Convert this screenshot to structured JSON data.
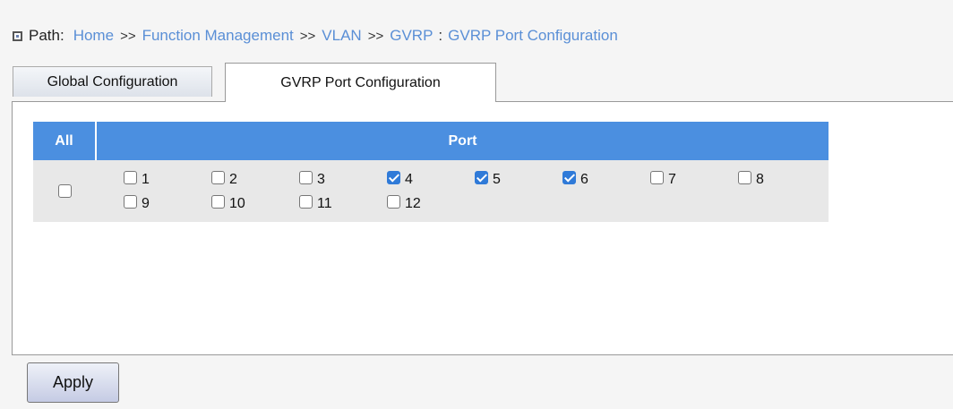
{
  "breadcrumb": {
    "label": "Path:",
    "items": [
      "Home",
      "Function Management",
      "VLAN",
      "GVRP",
      "GVRP Port Configuration"
    ],
    "separator": ">>",
    "last_separator": ":"
  },
  "tabs": [
    {
      "label": "Global Configuration",
      "active": false
    },
    {
      "label": "GVRP Port Configuration",
      "active": true
    }
  ],
  "table": {
    "headers": {
      "all": "All",
      "port": "Port"
    },
    "all_checked": false,
    "ports": [
      {
        "label": "1",
        "checked": false
      },
      {
        "label": "2",
        "checked": false
      },
      {
        "label": "3",
        "checked": false
      },
      {
        "label": "4",
        "checked": true
      },
      {
        "label": "5",
        "checked": true
      },
      {
        "label": "6",
        "checked": true
      },
      {
        "label": "7",
        "checked": false
      },
      {
        "label": "8",
        "checked": false
      },
      {
        "label": "9",
        "checked": false
      },
      {
        "label": "10",
        "checked": false
      },
      {
        "label": "11",
        "checked": false
      },
      {
        "label": "12",
        "checked": false
      }
    ]
  },
  "apply_label": "Apply",
  "colors": {
    "accent": "#4b8fe0",
    "link": "#5a8fd6",
    "checked": "#2f7ad8"
  }
}
